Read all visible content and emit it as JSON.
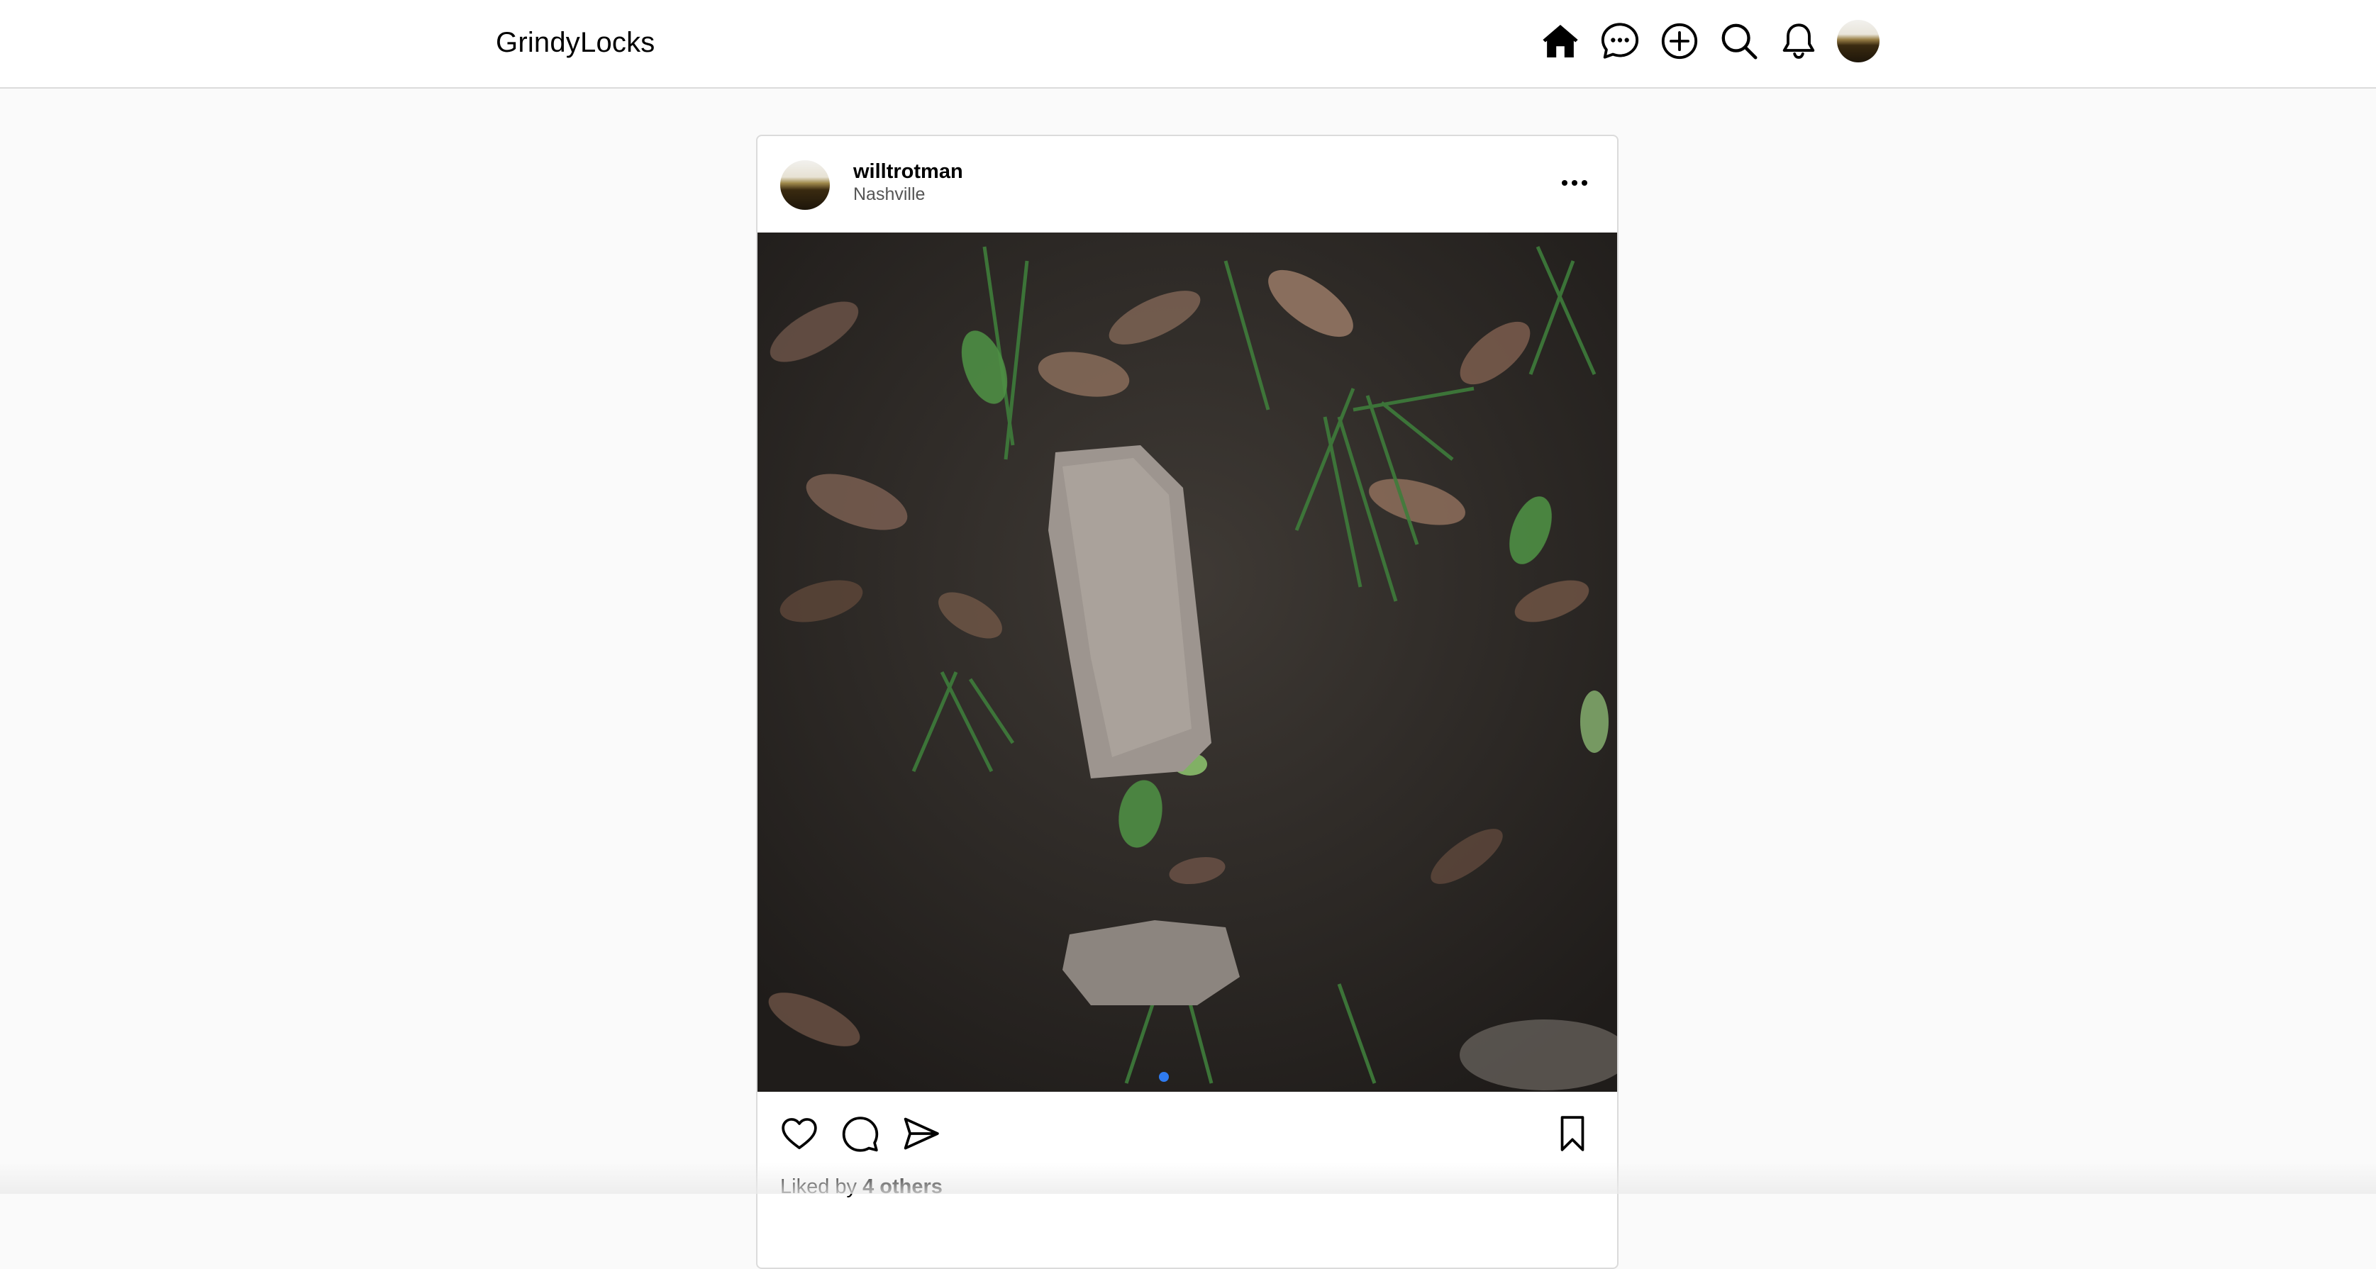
{
  "app": {
    "brand": "GrindyLocks"
  },
  "nav": {
    "items": [
      {
        "name": "home",
        "icon": "home-icon"
      },
      {
        "name": "messages",
        "icon": "chat-bubble-icon"
      },
      {
        "name": "create",
        "icon": "plus-circle-icon"
      },
      {
        "name": "search",
        "icon": "search-icon"
      },
      {
        "name": "notifications",
        "icon": "bell-icon"
      },
      {
        "name": "profile",
        "icon": "avatar"
      }
    ]
  },
  "post": {
    "username": "willtrotman",
    "location": "Nashville",
    "likes_prefix": "Liked by ",
    "likes_count_text": "4 others",
    "carousel": {
      "current_index": 1,
      "dot_color": "#2f7bf0"
    }
  },
  "colors": {
    "topbar_bg": "#ffffff",
    "page_bg": "#fafafa",
    "border": "#dbdbdb",
    "accent": "#2f7bf0"
  }
}
